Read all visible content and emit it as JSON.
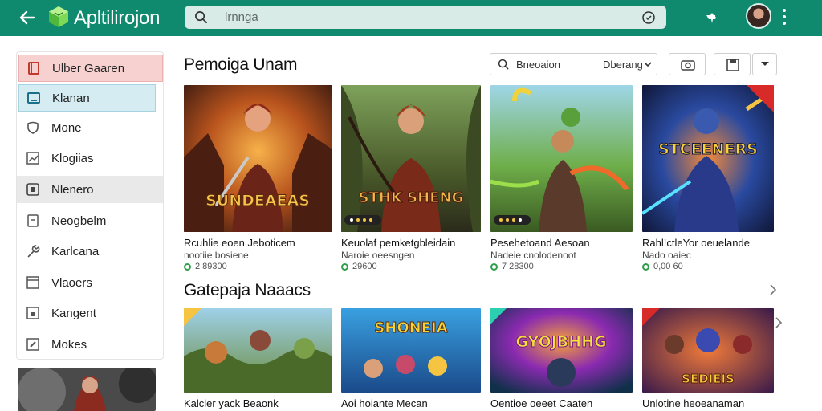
{
  "app": {
    "title": "Apltilirojon"
  },
  "search": {
    "placeholder": "lrnnga"
  },
  "sidebar": {
    "items": [
      {
        "label": "Ulber Gaaren",
        "icon": "book-icon",
        "state": "red"
      },
      {
        "label": "Klanan",
        "icon": "screen-icon",
        "state": "blue"
      },
      {
        "label": "Mone",
        "icon": "shield-icon",
        "state": ""
      },
      {
        "label": "Klogiias",
        "icon": "chart-icon",
        "state": ""
      },
      {
        "label": "Nlenero",
        "icon": "square-icon",
        "state": "grey"
      },
      {
        "label": "Neogbelm",
        "icon": "document-icon",
        "state": ""
      },
      {
        "label": "Karlcana",
        "icon": "wrench-icon",
        "state": ""
      },
      {
        "label": "Vlaoers",
        "icon": "window-icon",
        "state": ""
      },
      {
        "label": "Kangent",
        "icon": "lock-icon",
        "state": ""
      },
      {
        "label": "Mokes",
        "icon": "edit-icon",
        "state": ""
      }
    ]
  },
  "section1": {
    "title": "Pemoiga Unam",
    "sort_label": "Bneoaion",
    "sort_value": "Dberang",
    "cards": [
      {
        "title": "Rcuhlie eoen Jeboticem",
        "subtitle": "nootiie bosiene",
        "meta": "2 89300",
        "overlay": "SUNDEAEAS"
      },
      {
        "title": "Keuolaf pemketgbleidain",
        "subtitle": "Naroie oeesngen",
        "meta": "29600",
        "overlay": "STHK SHENG"
      },
      {
        "title": "Pesehetoand Aesoan",
        "subtitle": "Nadeie cnolodenoot",
        "meta": "7 28300",
        "overlay": ""
      },
      {
        "title": "Rahl!ctleYor oeuelande",
        "subtitle": "Nado oaiec",
        "meta": "0,00 60",
        "overlay": "STCEENERS"
      }
    ]
  },
  "section2": {
    "title": "Gatepaja Naaacs",
    "cards": [
      {
        "title": "Kalcler yack Beaonk",
        "overlay": ""
      },
      {
        "title": "Aoi hoiante Mecan",
        "overlay": "SHONEIA"
      },
      {
        "title": "Oentioe oeeet Caaten",
        "overlay": "GYOJBHHG"
      },
      {
        "title": "Unlotine heoeanaman",
        "overlay": "SEDIEIS"
      }
    ]
  },
  "colors": {
    "topbar": "#0f8a6e",
    "accent_green": "#2e9e4b"
  }
}
